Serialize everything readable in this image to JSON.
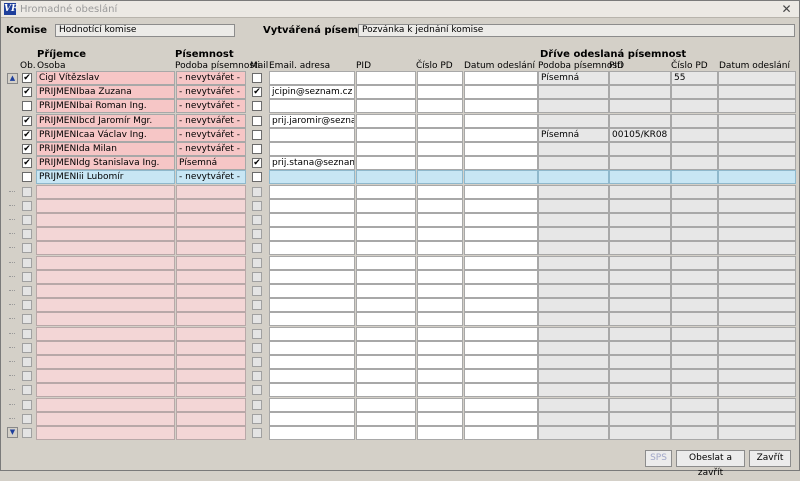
{
  "window": {
    "title": "Hromadné obeslání",
    "close": "✕",
    "app_icon": "VF"
  },
  "form": {
    "komise_label": "Komise",
    "komise_value": "Hodnotící komise",
    "pisemnost_label": "Vytvářená písemnost",
    "pisemnost_value": "Pozvánka k jednání komise"
  },
  "groups": {
    "prijemce": "Příjemce",
    "pisemnost": "Písemnost",
    "drive": "Dříve odeslaná písemnost"
  },
  "columns": {
    "ob": "Ob.",
    "osoba": "Osoba",
    "podoba": "Podoba písemnosti",
    "mail": "Mail",
    "email": "Email. adresa",
    "pid": "PID",
    "cislo_pd": "Číslo PD",
    "datum": "Datum odeslání",
    "prev_podoba": "Podoba písemnosti",
    "prev_pid": "PID",
    "prev_cislo": "Číslo PD",
    "prev_datum": "Datum odeslání"
  },
  "rows": [
    {
      "ob": true,
      "osoba": "Cigl Vítězslav",
      "podoba": "- nevytvářet -",
      "mail": false,
      "email": "",
      "prev_podoba": "Písemná",
      "prev_pid": "",
      "prev_cislo": "55"
    },
    {
      "ob": true,
      "osoba": "PRIJMENIbaa Zuzana",
      "podoba": "- nevytvářet -",
      "mail": true,
      "email": "jcipin@seznam.cz",
      "prev_podoba": "",
      "prev_pid": "",
      "prev_cislo": ""
    },
    {
      "ob": false,
      "osoba": "PRIJMENIbai Roman Ing.",
      "podoba": "- nevytvářet -",
      "mail": false,
      "email": "",
      "prev_podoba": "",
      "prev_pid": "",
      "prev_cislo": ""
    },
    {
      "ob": true,
      "osoba": "PRIJMENIbcd Jaromír Mgr.",
      "podoba": "- nevytvářet -",
      "mail": false,
      "email": "prij.jaromir@seznam.c",
      "prev_podoba": "",
      "prev_pid": "",
      "prev_cislo": ""
    },
    {
      "ob": true,
      "osoba": "PRIJMENIcaa Václav Ing.",
      "podoba": "- nevytvářet -",
      "mail": false,
      "email": "",
      "prev_podoba": "Písemná",
      "prev_pid": "00105/KR08",
      "prev_cislo": ""
    },
    {
      "ob": true,
      "osoba": "PRIJMENIda Milan",
      "podoba": "- nevytvářet -",
      "mail": false,
      "email": "",
      "prev_podoba": "",
      "prev_pid": "",
      "prev_cislo": ""
    },
    {
      "ob": true,
      "osoba": "PRIJMENIdg Stanislava Ing.",
      "podoba": "Písemná",
      "mail": true,
      "email": "prij.stana@seznam.cz",
      "prev_podoba": "",
      "prev_pid": "",
      "prev_cislo": ""
    },
    {
      "ob": false,
      "osoba": "PRIJMENIii Lubomír",
      "podoba": "- nevytvářet -",
      "mail": false,
      "email": "",
      "prev_podoba": "",
      "prev_pid": "",
      "prev_cislo": "",
      "selected": true
    }
  ],
  "empty_rows": 18,
  "buttons": {
    "sps": "SPS",
    "obeslat": "Obeslat a zavřít",
    "zavrit": "Zavřít"
  },
  "icons": {
    "check": "✔",
    "scroll_up": "▲",
    "scroll_down": "▼"
  },
  "colors": {
    "pink": "#f6c6c6",
    "selected": "#c8e6f4",
    "title_icon": "#1e3f9c"
  }
}
